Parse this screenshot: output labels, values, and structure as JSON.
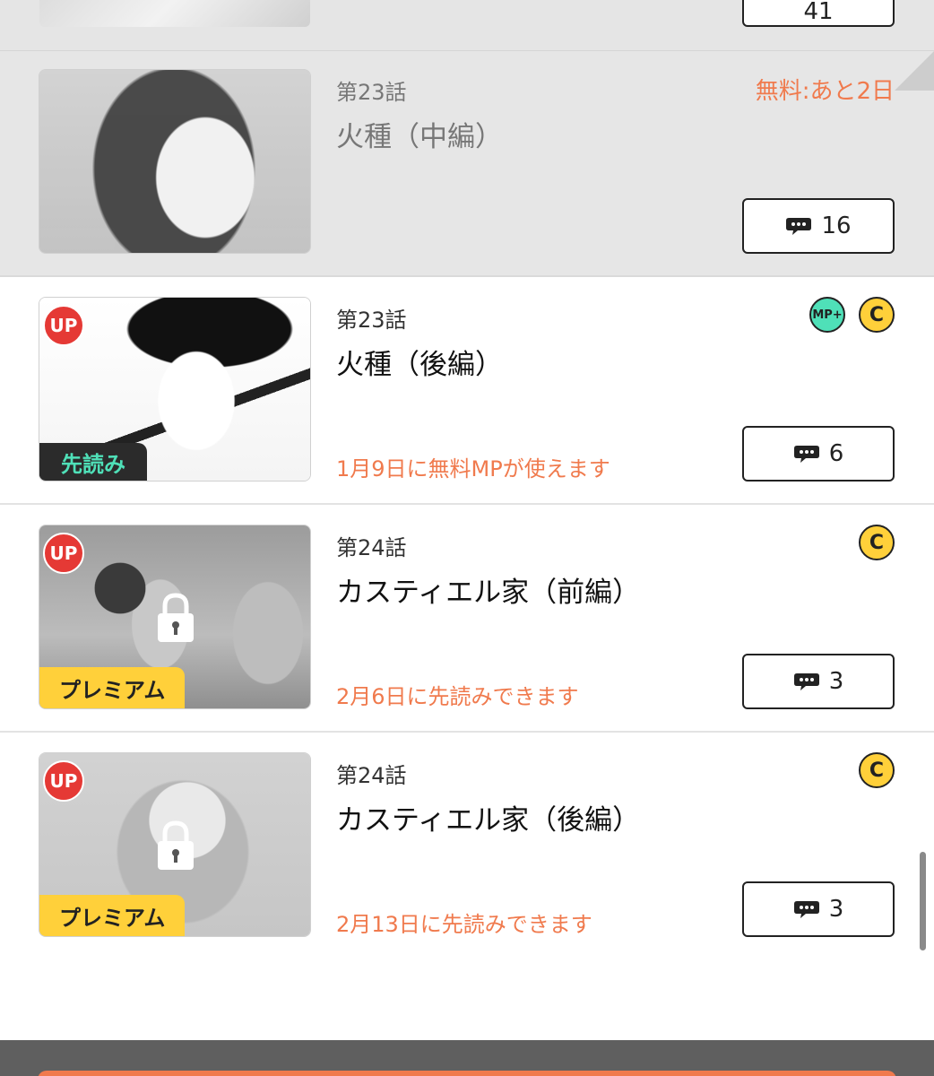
{
  "previous_row": {
    "comment_count": "41"
  },
  "episodes": [
    {
      "number": "第23話",
      "title": "火種（中編）",
      "free_label": "無料:あと2日",
      "comment_count": "16",
      "state": "read"
    },
    {
      "number": "第23話",
      "title": "火種（後編）",
      "badge": "UP",
      "ribbon": "先読み",
      "currency": [
        "MP+",
        "C"
      ],
      "note": "1月9日に無料MPが使えます",
      "comment_count": "6"
    },
    {
      "number": "第24話",
      "title": "カスティエル家（前編）",
      "badge": "UP",
      "ribbon": "プレミアム",
      "locked": true,
      "currency": [
        "C"
      ],
      "note": "2月6日に先読みできます",
      "comment_count": "3"
    },
    {
      "number": "第24話",
      "title": "カスティエル家（後編）",
      "badge": "UP",
      "ribbon": "プレミアム",
      "locked": true,
      "currency": [
        "C"
      ],
      "note": "2月13日に先読みできます",
      "comment_count": "3"
    }
  ],
  "colors": {
    "accent_orange": "#f07a4d",
    "up_red": "#e53935",
    "coin_yellow": "#ffd03a",
    "mp_teal": "#4fe0b8",
    "read_row_bg": "#e6e6e6"
  },
  "icons": {
    "comment": "speech-bubble-icon",
    "lock": "lock-icon",
    "coin": "coin-c-icon",
    "mp": "mp-plus-icon"
  }
}
